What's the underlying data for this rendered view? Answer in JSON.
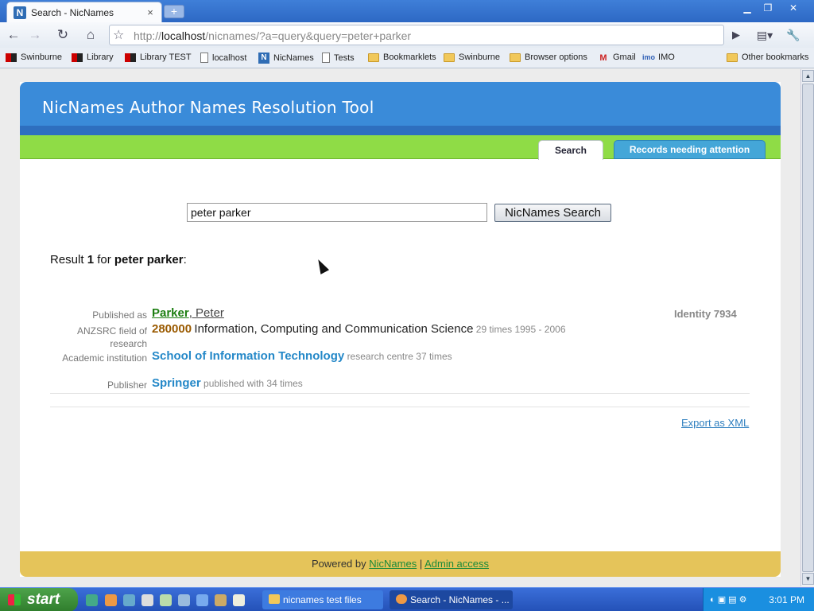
{
  "browser": {
    "tab_title": "Search - NicNames",
    "tab_favicon": "N",
    "tab_close": "×",
    "new_tab": "+",
    "url_scheme": "http://",
    "url_host": "localhost",
    "url_path": "/nicnames/?a=query&query=peter+parker",
    "bookmarks": [
      "Swinburne",
      "Library",
      "Library TEST",
      "localhost",
      "NicNames",
      "Tests",
      "Bookmarklets",
      "Swinburne",
      "Browser options",
      "Gmail",
      "IMO",
      "Other bookmarks"
    ],
    "bookmark_icons": {
      "gmail": "M",
      "imo": "imo",
      "nicnames": "N"
    }
  },
  "app": {
    "title": "NicNames Author Names Resolution Tool",
    "tabs": {
      "search": "Search",
      "attention": "Records needing attention"
    },
    "search": {
      "value": "peter parker",
      "button": "NicNames Search"
    },
    "result": {
      "prefix": "Result ",
      "count": "1",
      "for": " for ",
      "query": "peter parker",
      "suffix": ":"
    },
    "record": {
      "published_as_label": "Published as",
      "surname": "Parker",
      "given": ", Peter",
      "identity": "Identity 7934",
      "field_label": "ANZSRC field of research",
      "field_code": "280000",
      "field_name": "Information, Computing and Communication Science",
      "field_stats": "29 times 1995 - 2006",
      "institution_label": "Academic institution",
      "institution_name": "School of Information Technology",
      "institution_stats": "research centre 37 times",
      "publisher_label": "Publisher",
      "publisher_name": "Springer",
      "publisher_stats": "published with 34 times"
    },
    "export": "Export as XML",
    "footer": {
      "powered_by": "Powered by ",
      "nicnames": "NicNames",
      "sep": " | ",
      "admin": "Admin access"
    }
  },
  "taskbar": {
    "start": "start",
    "tasks": [
      "nicnames test files",
      "Search - NicNames - ..."
    ],
    "clock": "3:01 PM"
  },
  "colors": {
    "header_blue": "#3a8bd9",
    "band_green": "#8fdc46",
    "footer_gold": "#e5c45a",
    "link_green": "#1d7f12",
    "link_blue": "#2488c8"
  }
}
